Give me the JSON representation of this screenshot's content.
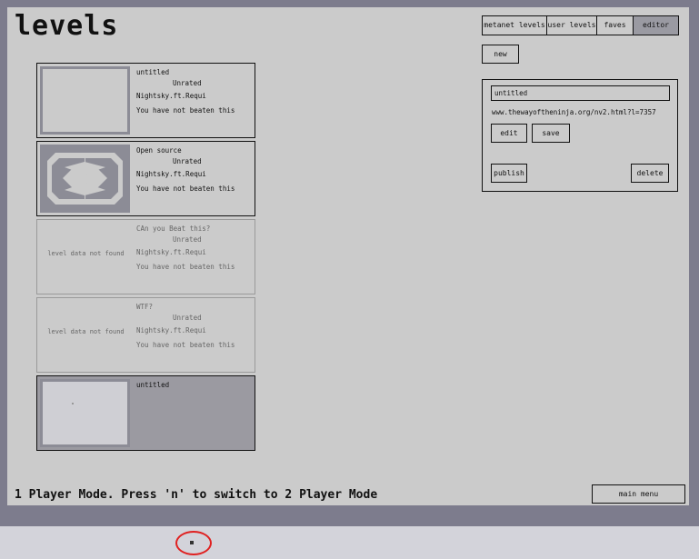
{
  "page": {
    "title": "levels",
    "mode_text": "1 Player Mode. Press 'n' to switch to 2 Player Mode",
    "main_menu_label": "main menu"
  },
  "tabs": [
    {
      "label": "metanet levels",
      "active": false
    },
    {
      "label": "user levels",
      "active": false
    },
    {
      "label": "faves",
      "active": false
    },
    {
      "label": "editor",
      "active": true
    }
  ],
  "new_label": "new",
  "levels": [
    {
      "title": "untitled",
      "rating": "Unrated",
      "author": "Nightsky.ft.Requi",
      "status": "You have not beaten this",
      "thumb": "blank"
    },
    {
      "title": "Open source",
      "rating": "Unrated",
      "author": "Nightsky.ft.Requi",
      "status": "You have not beaten this",
      "thumb": "pattern"
    },
    {
      "title": "CAn you Beat this?",
      "rating": "Unrated",
      "author": "Nightsky.ft.Requi",
      "status": "You have not beaten this",
      "thumb_text": "level data not found"
    },
    {
      "title": "WTF?",
      "rating": "Unrated",
      "author": "Nightsky.ft.Requi",
      "status": "You have not beaten this",
      "thumb_text": "level data not found"
    },
    {
      "title": "untitled",
      "thumb": "blank-selected"
    }
  ],
  "editor": {
    "name_value": "untitled",
    "url": "www.thewayoftheninja.org/nv2.html?l=7357",
    "edit_label": "edit",
    "save_label": "save",
    "publish_label": "publish",
    "delete_label": "delete"
  },
  "colors": {
    "background": "#7d7c8d",
    "panel": "#cbcbcb",
    "thumb_border": "#8c8c96",
    "selected_row": "#9b9aa1",
    "cursor_highlight": "#e02020"
  },
  "icons": {
    "thumb_pattern": "level-pattern-icon",
    "cursor": "mouse-cursor-icon"
  }
}
